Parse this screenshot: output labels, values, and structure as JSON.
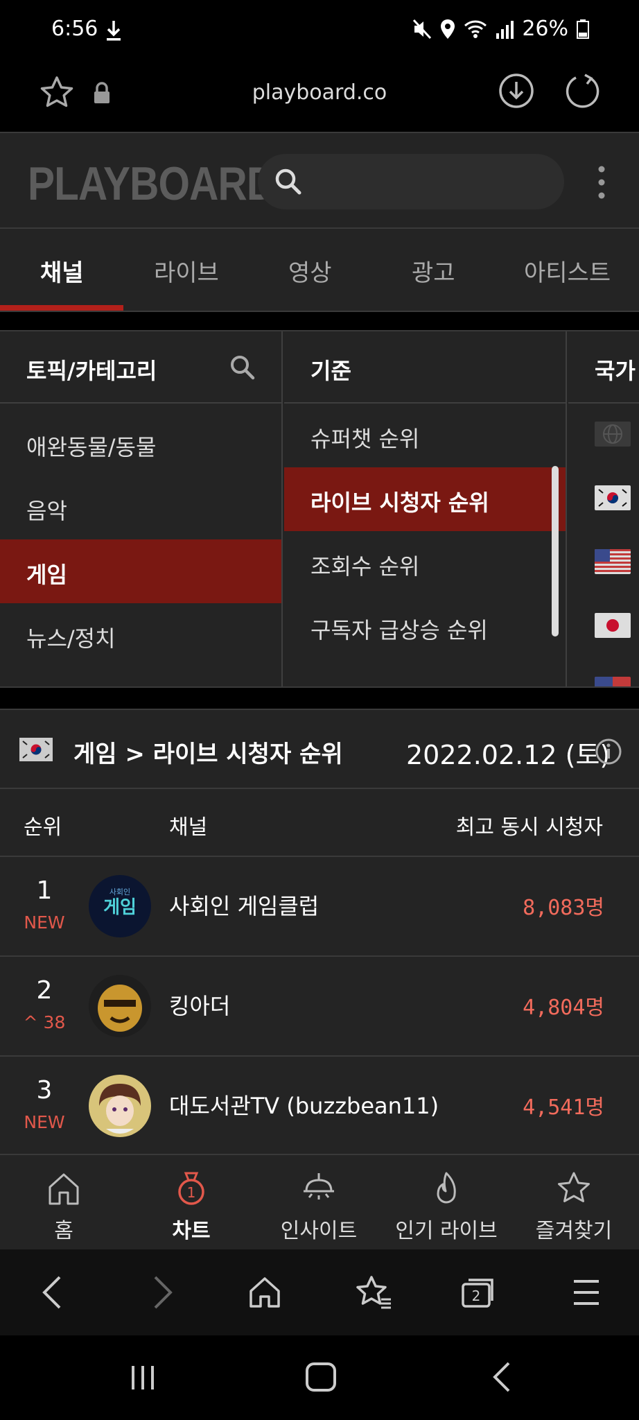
{
  "status": {
    "time": "6:56",
    "battery": "26%"
  },
  "browser": {
    "url": "playboard.co"
  },
  "site": {
    "logo": "PLAYBOARD"
  },
  "tabs": [
    "채널",
    "라이브",
    "영상",
    "광고",
    "아티스트"
  ],
  "filters": {
    "topic_head": "토픽/카테고리",
    "topics": [
      "애완동물/동물",
      "음악",
      "게임",
      "뉴스/정치"
    ],
    "basis_head": "기준",
    "basis": [
      "슈퍼챗 순위",
      "라이브 시청자 순위",
      "조회수 순위",
      "구독자 급상승 순위"
    ],
    "country_head": "국가"
  },
  "result": {
    "title": "게임 > 라이브 시청자 순위",
    "date": "2022.02.12 (토)"
  },
  "table": {
    "headers": {
      "rank": "순위",
      "channel": "채널",
      "viewers": "최고 동시 시청자"
    },
    "rows": [
      {
        "rank": "1",
        "sub": "NEW",
        "name": "사회인 게임클럽",
        "viewers": "8,083명"
      },
      {
        "rank": "2",
        "sub": "^ 38",
        "name": "킹아더",
        "viewers": "4,804명"
      },
      {
        "rank": "3",
        "sub": "NEW",
        "name": "대도서관TV (buzzbean11)",
        "viewers": "4,541명"
      }
    ]
  },
  "nav": [
    "홈",
    "차트",
    "인사이트",
    "인기 라이브",
    "즐겨찾기"
  ],
  "browser_tabs_count": "2",
  "chart_badge": "1",
  "colors": {
    "accent": "#b3201a",
    "active_bg": "#7a1812",
    "viewer_text": "#f26b5c",
    "panel_bg": "#242424"
  }
}
